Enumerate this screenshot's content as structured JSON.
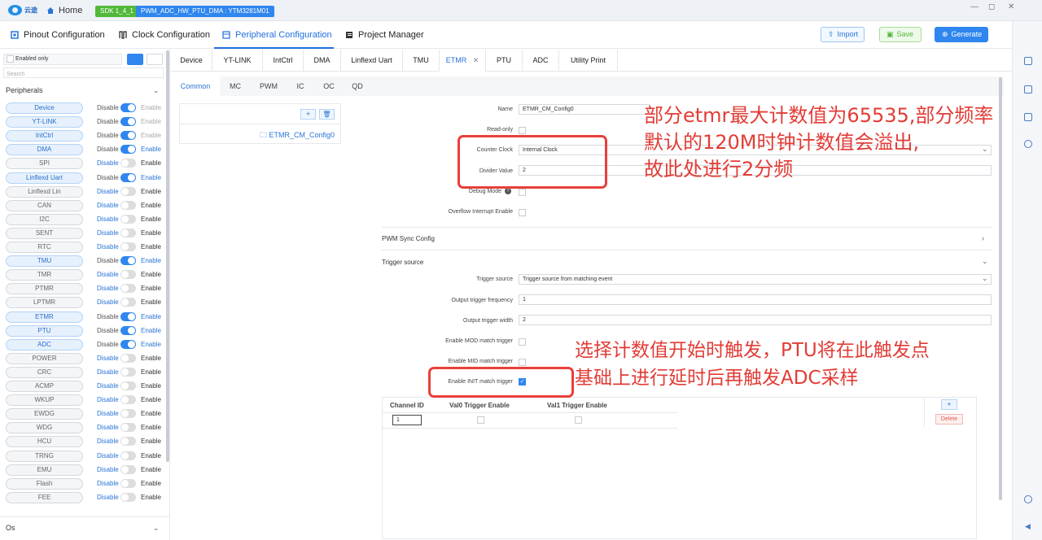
{
  "titlebar": {
    "brand": "云途",
    "home": "Home",
    "sdk": "SDK 1_4_1",
    "project": "PWM_ADC_HW_PTU_DMA : YTM3281M01",
    "win": [
      "—",
      "◻",
      "✕"
    ]
  },
  "nav": {
    "tabs": [
      "Pinout Configuration",
      "Clock Configuration",
      "Peripheral Configuration",
      "Project Manager"
    ],
    "import": "Import",
    "save": "Save",
    "generate": "Generate"
  },
  "sidebar": {
    "enabled_only": "Enabled only",
    "search_placeholder": "Search",
    "section": "Peripherals",
    "bottom_section": "Os",
    "items": [
      {
        "name": "Device",
        "on": true,
        "dis": "Disable",
        "en": "Enable"
      },
      {
        "name": "YT-LINK",
        "on": true,
        "dis": "Disable",
        "en": "Enable"
      },
      {
        "name": "IntCtrl",
        "on": true,
        "dis": "Disable",
        "en": "Enable"
      },
      {
        "name": "DMA",
        "on": true,
        "dis": "Disable",
        "en": "Enable"
      },
      {
        "name": "SPI",
        "on": false,
        "dis": "Disable",
        "en": "Enable"
      },
      {
        "name": "Linflexd Uart",
        "on": true,
        "dis": "Disable",
        "en": "Enable"
      },
      {
        "name": "Linflexd Lin",
        "on": false,
        "dis": "Disable",
        "en": "Enable"
      },
      {
        "name": "CAN",
        "on": false,
        "dis": "Disable",
        "en": "Enable"
      },
      {
        "name": "I2C",
        "on": false,
        "dis": "Disable",
        "en": "Enable"
      },
      {
        "name": "SENT",
        "on": false,
        "dis": "Disable",
        "en": "Enable"
      },
      {
        "name": "RTC",
        "on": false,
        "dis": "Disable",
        "en": "Enable"
      },
      {
        "name": "TMU",
        "on": true,
        "dis": "Disable",
        "en": "Enable"
      },
      {
        "name": "TMR",
        "on": false,
        "dis": "Disable",
        "en": "Enable"
      },
      {
        "name": "PTMR",
        "on": false,
        "dis": "Disable",
        "en": "Enable"
      },
      {
        "name": "LPTMR",
        "on": false,
        "dis": "Disable",
        "en": "Enable"
      },
      {
        "name": "ETMR",
        "on": true,
        "dis": "Disable",
        "en": "Enable"
      },
      {
        "name": "PTU",
        "on": true,
        "dis": "Disable",
        "en": "Enable"
      },
      {
        "name": "ADC",
        "on": true,
        "dis": "Disable",
        "en": "Enable"
      },
      {
        "name": "POWER",
        "on": false,
        "dis": "Disable",
        "en": "Enable"
      },
      {
        "name": "CRC",
        "on": false,
        "dis": "Disable",
        "en": "Enable"
      },
      {
        "name": "ACMP",
        "on": false,
        "dis": "Disable",
        "en": "Enable"
      },
      {
        "name": "WKUP",
        "on": false,
        "dis": "Disable",
        "en": "Enable"
      },
      {
        "name": "EWDG",
        "on": false,
        "dis": "Disable",
        "en": "Enable"
      },
      {
        "name": "WDG",
        "on": false,
        "dis": "Disable",
        "en": "Enable"
      },
      {
        "name": "HCU",
        "on": false,
        "dis": "Disable",
        "en": "Enable"
      },
      {
        "name": "TRNG",
        "on": false,
        "dis": "Disable",
        "en": "Enable"
      },
      {
        "name": "EMU",
        "on": false,
        "dis": "Disable",
        "en": "Enable"
      },
      {
        "name": "Flash",
        "on": false,
        "dis": "Disable",
        "en": "Enable"
      },
      {
        "name": "FEE",
        "on": false,
        "dis": "Disable",
        "en": "Enable"
      }
    ]
  },
  "ptabs": [
    "Device",
    "YT-LINK",
    "IntCtrl",
    "DMA",
    "Linflexd Uart",
    "TMU",
    "ETMR",
    "PTU",
    "ADC",
    "Utility Print"
  ],
  "stabs": [
    "Common",
    "MC",
    "PWM",
    "IC",
    "OC",
    "QD"
  ],
  "config_list": {
    "item": "ETMR_CM_Config0"
  },
  "form": {
    "name_lbl": "Name",
    "name_val": "ETMR_CM_Config0",
    "readonly_lbl": "Read-only",
    "clock_lbl": "Counter Clock",
    "clock_val": "Internal Clock",
    "divider_lbl": "Divider Value",
    "divider_val": "2",
    "debug_lbl": "Debug Mode",
    "overflow_lbl": "Overflow Interrupt Enable",
    "pwm_sync": "PWM Sync Config",
    "trigger_section": "Trigger source",
    "trig_src_lbl": "Trigger source",
    "trig_src_val": "Trigger source from matching event",
    "out_freq_lbl": "Output trigger frequency",
    "out_freq_val": "1",
    "out_width_lbl": "Output trigger width",
    "out_width_val": "2",
    "mod_lbl": "Enable MOD match trigger",
    "mid_lbl": "Enable MID match trigger",
    "init_lbl": "Enable INIT match trigger"
  },
  "table": {
    "headers": [
      "Channel ID",
      "Val0 Trigger Enable",
      "Val1 Trigger Enable"
    ],
    "row": {
      "channel": "1"
    },
    "delete": "Delete"
  },
  "annotations": {
    "a1": [
      "部分etmr最大计数值为65535,部分频率",
      "默认的120M时钟计数值会溢出,",
      "故此处进行2分频"
    ],
    "a2": [
      "选择计数值开始时触发，PTU将在此触发点",
      "基础上进行延时后再触发ADC采样"
    ]
  },
  "colors": {
    "accent": "#1f6fe0",
    "annotation": "#e23c36",
    "sdk_badge": "#52b83a",
    "project_badge": "#2f86ee",
    "save": "#52b83a"
  }
}
